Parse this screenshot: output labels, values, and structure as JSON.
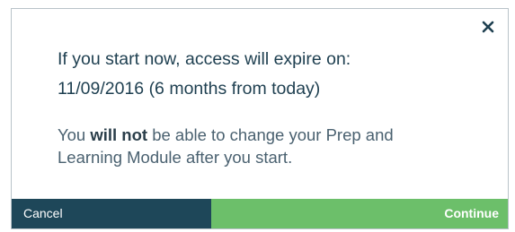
{
  "dialog": {
    "close_icon": "close-icon",
    "heading_line1": "If you start now, access will expire on:",
    "heading_line2": "11/09/2016 (6 months from today)",
    "body_prefix": "You ",
    "body_emphasis": "will not",
    "body_line1_suffix": " be able to change your Prep and",
    "body_line2": "Learning Module after you start.",
    "cancel_label": "Cancel",
    "continue_label": "Continue"
  },
  "colors": {
    "heading_text": "#1e3f50",
    "body_text": "#4a6170",
    "cancel_bg": "#1e4759",
    "continue_bg": "#6cbf6a",
    "close_icon": "#1e3f50"
  }
}
